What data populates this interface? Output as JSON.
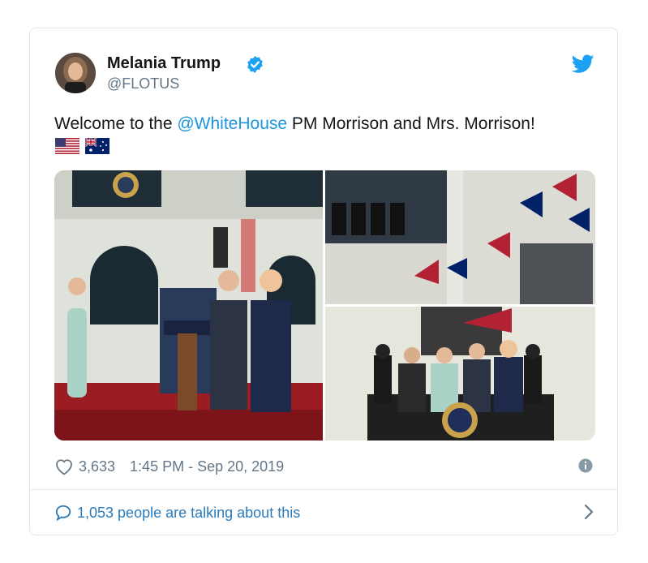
{
  "tweet": {
    "author_name": "Melania Trump",
    "author_handle": "@FLOTUS",
    "text_before": "Welcome to the ",
    "mention": "@WhiteHouse",
    "text_after": " PM Morrison and Mrs. Morrison!",
    "flags": [
      "us-flag",
      "australia-flag"
    ],
    "like_count": "3,633",
    "timestamp": "1:45 PM - Sep 20, 2019",
    "talking_label": "1,053 people are talking about this"
  },
  "colors": {
    "link": "#1b95e0",
    "muted": "#657786",
    "verified": "#1da1f2",
    "border": "#e1e8ed"
  },
  "icons": {
    "brand": "twitter-bird-icon",
    "verified": "verified-badge-icon",
    "like": "heart-icon",
    "info": "info-icon",
    "conversation": "speech-bubble-icon",
    "chevron": "chevron-right-icon"
  }
}
